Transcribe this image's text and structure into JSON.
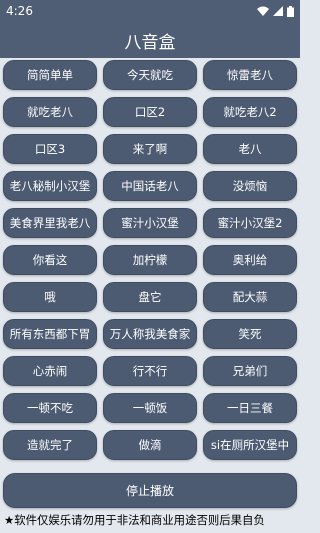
{
  "status_bar": {
    "time": "4:26",
    "icons": [
      "wifi-icon",
      "signal-icon",
      "battery-icon"
    ]
  },
  "app_bar": {
    "title": "八音盒"
  },
  "buttons": [
    "简简单单",
    "今天就吃",
    "惊雷老八",
    "就吃老八",
    "口区2",
    "就吃老八2",
    "口区3",
    "来了啊",
    "老八",
    "老八秘制小汉堡",
    "中国话老八",
    "没烦恼",
    "美食界里我老八",
    "蜜汁小汉堡",
    "蜜汁小汉堡2",
    "你看这",
    "加柠檬",
    "奥利给",
    "哦",
    "盘它",
    "配大蒜",
    "所有东西都下胃",
    "万人称我美食家",
    "笑死",
    "心赤闹",
    "行不行",
    "兄弟们",
    "一顿不吃",
    "一顿饭",
    "一日三餐",
    "造就完了",
    "做滴",
    "si在厕所汉堡中"
  ],
  "stop_button": {
    "label": "停止播放"
  },
  "disclaimer": "★软件仅娱乐请勿用于非法和商业用途否则后果自负",
  "colors": {
    "bar": "#4f5e74",
    "button": "#4c5b72",
    "background": "#e3e8ee",
    "text_on_button": "#ffffff"
  }
}
